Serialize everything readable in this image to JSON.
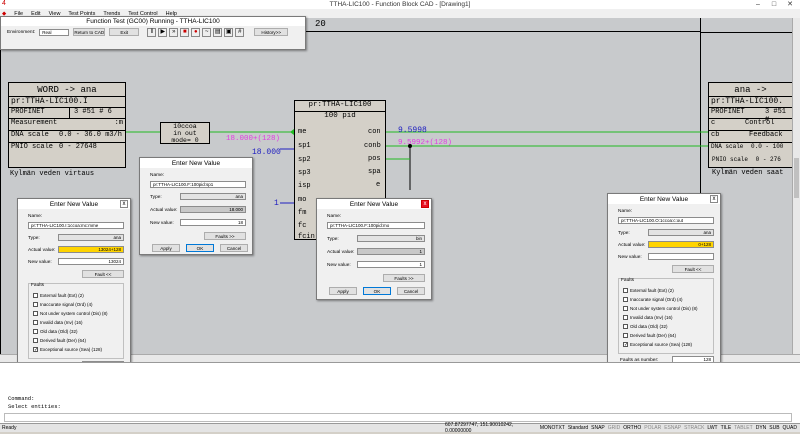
{
  "window": {
    "title": "TTHA-LIC100 - Function Block CAD - [Drawing1]",
    "controls": [
      "–",
      "□",
      "✕"
    ]
  },
  "menu": [
    "File",
    "Edit",
    "View",
    "Test Points",
    "Trends",
    "Test Control",
    "Help"
  ],
  "test_panel": {
    "title": "Function Test (GC00) Running - TTHA-LIC100",
    "environment_label": "Environment:",
    "environment_value": "Real",
    "return_button": "Return to CAD",
    "exit_button": "Exit",
    "history_button": "History>>",
    "icons": [
      "pause-icon",
      "play-icon",
      "step-icon",
      "stop-icon",
      "watch-icon",
      "trend-icon",
      "table-icon",
      "print-icon",
      "grid-icon"
    ]
  },
  "sheet_number": "20",
  "word_block": {
    "title": "WORD -> ana",
    "tag": "pr:TTHA-LIC100.I",
    "profinet": "PROFINET",
    "addr": "3 #51 # 6",
    "measurement": "Measurement",
    "dna_label": "DNA scale",
    "dna_value": "0.0 - 36.0 m3/h",
    "pnio_label": "PNIO scale",
    "pnio_value": "0 - 27648",
    "description": "Kylmän veden virtaus",
    "pin": ":m"
  },
  "ccoa_block": {
    "line1": "10ccoa",
    "line2": "in     out",
    "line3": "mode= 0"
  },
  "pid_block": {
    "header": "pr:TTHA-LIC100",
    "type": "100 pid",
    "inputs": [
      "me",
      "sp1",
      "sp2",
      "sp3",
      "isp",
      "mo",
      "fm",
      "fc",
      "fcin"
    ],
    "outputs": [
      "con",
      "conb",
      "pos",
      "spa",
      "e"
    ]
  },
  "values": {
    "me_value": "18.000+(128)",
    "sp1_value": "18.000",
    "mo_value": "1",
    "con_value": "9.5998",
    "conb_value": "9.5992+(128)"
  },
  "ana_block": {
    "title": "ana -> ",
    "tag": "pr:TTHA-LIC100.",
    "profinet": "PROFINET",
    "addr": "3 #51 #",
    "control": "Control",
    "feedback": "Feedback",
    "dna_label": "DNA scale",
    "dna_value": "0.0 - 100",
    "pnio_label": "PNIO scale",
    "pnio_value": "0 - 276",
    "description": "Kylmän veden saat",
    "pin_c": "c",
    "pin_cb": "cb"
  },
  "dialog_left": {
    "title": "Enter New Value",
    "name_label": "Name:",
    "name_value": "pr:TTHA-LIC100.I:1ccoa:mc:mme",
    "type_label": "Type:",
    "type_value": "ana",
    "actual_label": "Actual value:",
    "actual_value": "13024+128",
    "new_label": "New value:",
    "new_value": "13024",
    "fault_button": "Fault <<",
    "faults_label": "Faults",
    "faults": [
      {
        "label": "External fault (Ext) (2)",
        "checked": false
      },
      {
        "label": "Inaccurate signal (Ord) (4)",
        "checked": false
      },
      {
        "label": "Not under system control (Dis) (8)",
        "checked": false
      },
      {
        "label": "Invalid data (Inv) (16)",
        "checked": false
      },
      {
        "label": "Old data (Old) (32)",
        "checked": false
      },
      {
        "label": "Derived fault (Der) (64)",
        "checked": false
      },
      {
        "label": "Exceptional source (Sea) (128)",
        "checked": true
      }
    ],
    "faults_number_label": "Faults as number:",
    "faults_number": "128",
    "apply": "Apply",
    "ok": "OK",
    "cancel": "Cancel"
  },
  "dialog_mid1": {
    "title": "Enter New Value",
    "name_label": "Name:",
    "name_value": "pr:TTHA-LIC100.F:100pid:sp1",
    "type_label": "Type:",
    "type_value": "ana",
    "actual_label": "Actual value:",
    "actual_value": "18.000",
    "new_label": "New value:",
    "new_value": "18",
    "fault_button": "Faults >>",
    "apply": "Apply",
    "ok": "OK",
    "cancel": "Cancel"
  },
  "dialog_mid2": {
    "title": "Enter New Value",
    "name_label": "Name:",
    "name_value": "pr:TTHA-LIC100.F:100pid:mo",
    "type_label": "Type:",
    "type_value": "bin",
    "actual_label": "Actual value:",
    "actual_value": "1",
    "new_label": "New value:",
    "new_value": "1",
    "fault_button": "Faults >>",
    "apply": "Apply",
    "ok": "OK",
    "cancel": "Cancel"
  },
  "dialog_right": {
    "title": "Enter New Value",
    "name_label": "Name:",
    "name_value": "pr:TTHA-LIC100.O:1ccoa:c:out",
    "type_label": "Type:",
    "type_value": "ana",
    "actual_label": "Actual value:",
    "actual_value": "0+128",
    "new_label": "New value:",
    "new_value": "",
    "fault_button": "Fault <<",
    "faults_label": "Faults",
    "faults": [
      {
        "label": "External fault (Ext) (2)",
        "checked": false
      },
      {
        "label": "Inaccurate signal (Ord) (4)",
        "checked": false
      },
      {
        "label": "Not under system control (Dis) (8)",
        "checked": false
      },
      {
        "label": "Invalid data (Inv) (16)",
        "checked": false
      },
      {
        "label": "Old data (Old) (32)",
        "checked": false
      },
      {
        "label": "Derived fault (Der) (64)",
        "checked": false
      },
      {
        "label": "Exceptional source (Sea) (128)",
        "checked": true
      }
    ],
    "faults_number_label": "Faults as number:",
    "faults_number": "128",
    "apply": "Apply",
    "ok": "OK",
    "cancel": "Cancel"
  },
  "command": {
    "line1": "Command:",
    "line2": "Select entities:"
  },
  "status": {
    "left": "Ready",
    "coords": "607.87297747, 151.90010242, 0.00000000",
    "toggles": [
      "MONOTXT",
      "Standard",
      "SNAP",
      "GRID",
      "ORTHO",
      "POLAR",
      "ESNAP",
      "STRACK",
      "LWT",
      "TILE",
      "TABLET",
      "DYN",
      "SUB",
      "QUAD"
    ]
  },
  "colors": {
    "wire_green": "#22bb22",
    "wire_blue": "#2020c0",
    "pink": "#e040e0",
    "yellow": "#ffd400",
    "canvas": "#c8cacc"
  }
}
